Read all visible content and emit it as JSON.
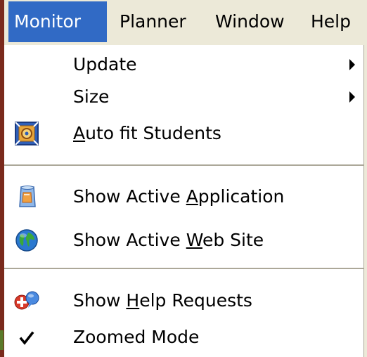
{
  "menubar": {
    "items": [
      {
        "label": "Monitor"
      },
      {
        "label": "Planner"
      },
      {
        "label": "Window"
      },
      {
        "label": "Help"
      }
    ]
  },
  "menu": {
    "items": [
      {
        "label": "Update",
        "submenu": true
      },
      {
        "label": "Size",
        "submenu": true
      },
      {
        "label_pre": "",
        "label_ul": "A",
        "label_post": "uto fit Students",
        "icon": "auto-fit-students-icon"
      },
      {
        "label_pre": "Show Active ",
        "label_ul": "A",
        "label_post": "pplication",
        "icon": "active-application-icon"
      },
      {
        "label_pre": "Show Active ",
        "label_ul": "W",
        "label_post": "eb Site",
        "icon": "globe-icon"
      },
      {
        "label_pre": "Show ",
        "label_ul": "H",
        "label_post": "elp Requests",
        "icon": "help-requests-icon"
      },
      {
        "label": "Zoomed Mode",
        "checked": true,
        "icon": "checkmark-icon"
      }
    ]
  },
  "colors": {
    "highlight": "#316ac5",
    "menubar_bg": "#ece9d8",
    "separator": "#aca899"
  }
}
